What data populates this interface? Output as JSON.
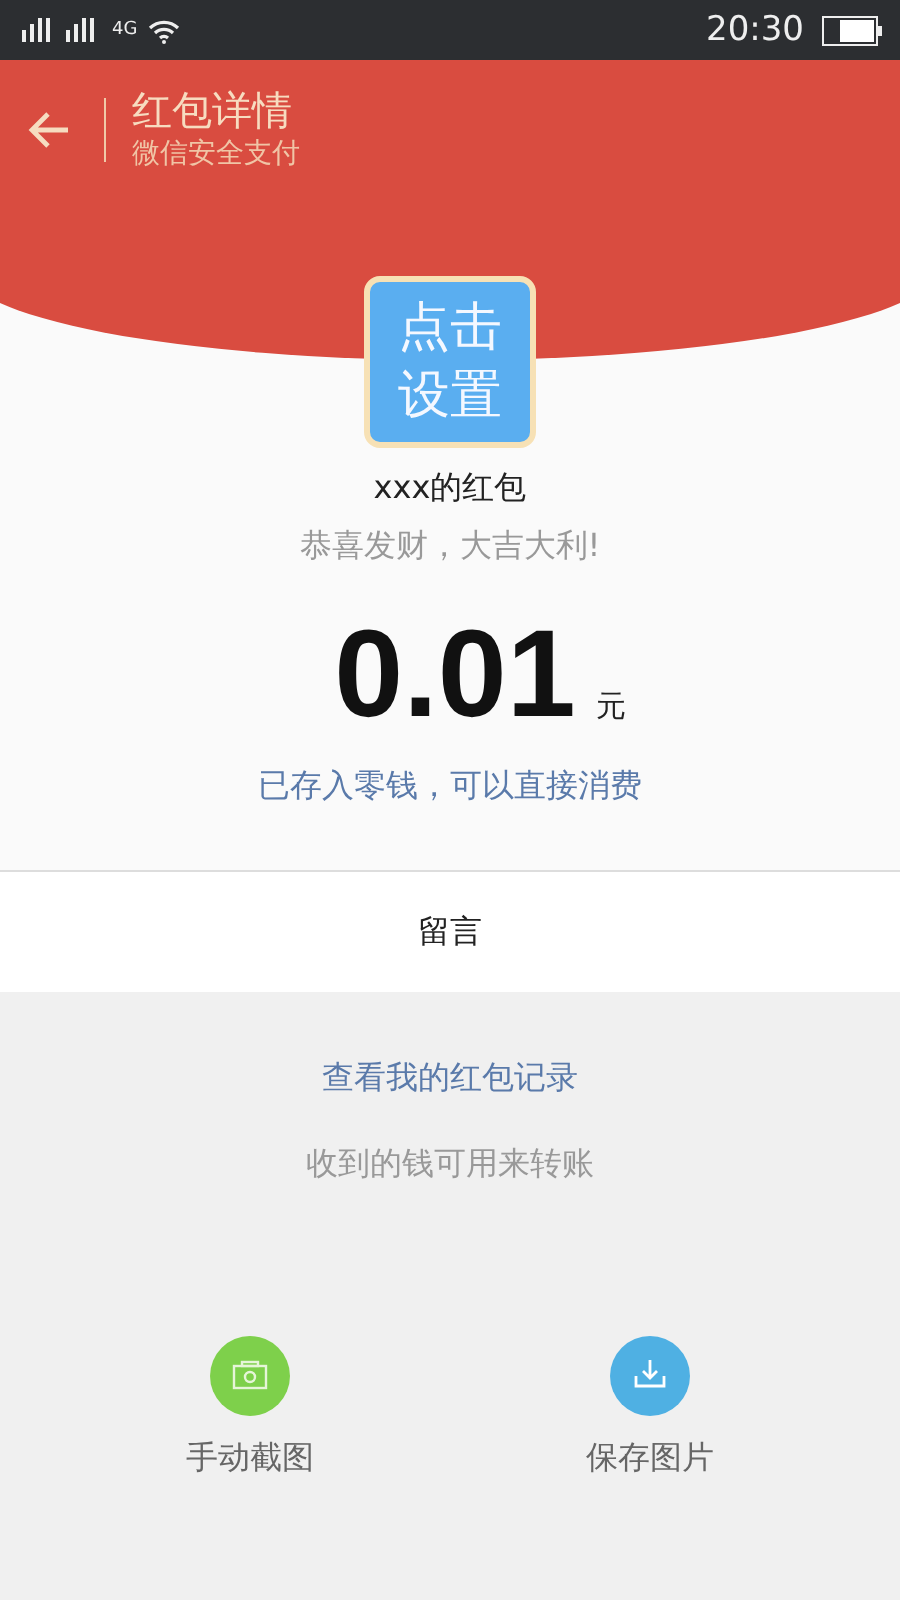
{
  "status_bar": {
    "network": "4G",
    "time": "20:30"
  },
  "header": {
    "title": "红包详情",
    "subtitle": "微信安全支付"
  },
  "avatar": {
    "text": "点击设置"
  },
  "sender": "xxx的红包",
  "greeting": "恭喜发财，大吉大利!",
  "amount": {
    "value": "0.01",
    "unit": "元"
  },
  "note": "已存入零钱，可以直接消费",
  "message_button": "留言",
  "records_link": "查看我的红包记录",
  "hint": "收到的钱可用来转账",
  "actions": [
    {
      "kind": "screenshot",
      "label": "手动截图",
      "color": "#7ed04b"
    },
    {
      "kind": "save",
      "label": "保存图片",
      "color": "#4fb0e3"
    }
  ]
}
